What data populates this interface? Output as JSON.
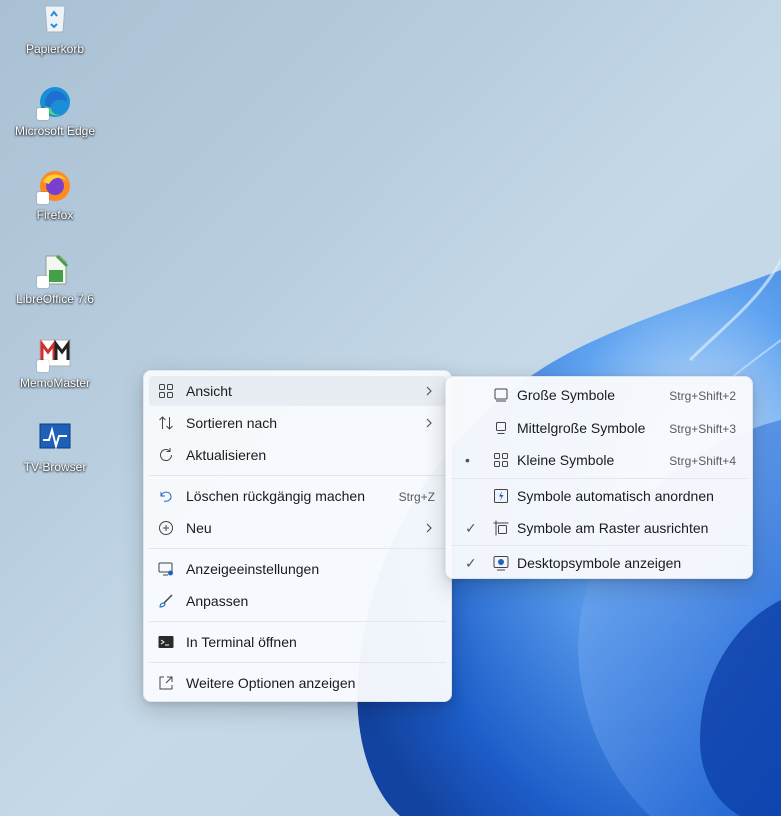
{
  "desktop": {
    "icons": [
      {
        "label": "Papierkorb",
        "icon": "recycle-bin-icon"
      },
      {
        "label": "Microsoft Edge",
        "icon": "edge-icon"
      },
      {
        "label": "Firefox",
        "icon": "firefox-icon"
      },
      {
        "label": "LibreOffice 7.6",
        "icon": "libreoffice-icon"
      },
      {
        "label": "MemoMaster",
        "icon": "memomaster-icon"
      },
      {
        "label": "TV-Browser",
        "icon": "tv-browser-icon"
      }
    ]
  },
  "context_menu": {
    "items": [
      {
        "label": "Ansicht",
        "icon": "grid-icon",
        "has_submenu": true,
        "highlighted": true
      },
      {
        "label": "Sortieren nach",
        "icon": "sort-icon",
        "has_submenu": true
      },
      {
        "label": "Aktualisieren",
        "icon": "refresh-icon"
      },
      {
        "label": "Löschen rückgängig machen",
        "icon": "undo-icon",
        "shortcut": "Strg+Z"
      },
      {
        "label": "Neu",
        "icon": "new-plus-icon",
        "has_submenu": true
      },
      {
        "label": "Anzeigeeinstellungen",
        "icon": "display-settings-icon"
      },
      {
        "label": "Anpassen",
        "icon": "brush-icon"
      },
      {
        "label": "In Terminal öffnen",
        "icon": "terminal-icon"
      },
      {
        "label": "Weitere Optionen anzeigen",
        "icon": "more-options-icon"
      }
    ]
  },
  "view_submenu": {
    "items": [
      {
        "label": "Große Symbole",
        "icon": "large-icons-icon",
        "shortcut": "Strg+Shift+2",
        "mark": ""
      },
      {
        "label": "Mittelgroße Symbole",
        "icon": "medium-icons-icon",
        "shortcut": "Strg+Shift+3",
        "mark": ""
      },
      {
        "label": "Kleine Symbole",
        "icon": "small-icons-icon",
        "shortcut": "Strg+Shift+4",
        "mark": "•"
      },
      {
        "label": "Symbole automatisch anordnen",
        "icon": "auto-arrange-icon",
        "mark": ""
      },
      {
        "label": "Symbole am Raster ausrichten",
        "icon": "align-grid-icon",
        "mark": "✓"
      },
      {
        "label": "Desktopsymbole anzeigen",
        "icon": "show-desktop-icons-icon",
        "mark": "✓"
      }
    ]
  },
  "colors": {
    "accent": "#0067c0",
    "wallpaper_bloom": "#1a6fe0",
    "menu_bg": "#f8fafd",
    "highlight": "#e8edf3"
  }
}
